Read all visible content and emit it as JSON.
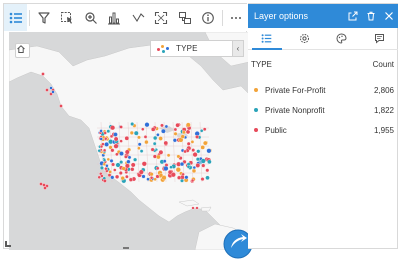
{
  "toolbar": {
    "buttons": [
      {
        "icon": "legend-list-icon",
        "active": true
      },
      {
        "icon": "filter-icon"
      },
      {
        "icon": "selection-icon"
      },
      {
        "icon": "zoom-icon"
      },
      {
        "icon": "bar-chart-icon"
      },
      {
        "icon": "line-tool-icon"
      },
      {
        "icon": "expand-icon"
      },
      {
        "icon": "map-layers-icon"
      },
      {
        "icon": "info-icon"
      },
      {
        "icon": "more-icon"
      }
    ]
  },
  "map": {
    "legend_label": "TYPE",
    "legend_collapse_glyph": "‹"
  },
  "panel": {
    "title": "Layer options",
    "tabs": [
      "legend-tab-icon",
      "settings-tab-icon",
      "style-tab-icon",
      "popup-tab-icon"
    ],
    "field_label": "TYPE",
    "count_label": "Count",
    "rows": [
      {
        "label": "Private For-Profit",
        "count": "2,806",
        "color": "#f2a33a"
      },
      {
        "label": "Private Nonprofit",
        "count": "1,822",
        "color": "#2aa3b9"
      },
      {
        "label": "Public",
        "count": "1,955",
        "color": "#e74a5a"
      }
    ]
  },
  "colors": {
    "accent": "#2f8ad8",
    "for_profit": "#f2a33a",
    "nonprofit": "#2aa3b9",
    "public": "#e74a5a"
  }
}
